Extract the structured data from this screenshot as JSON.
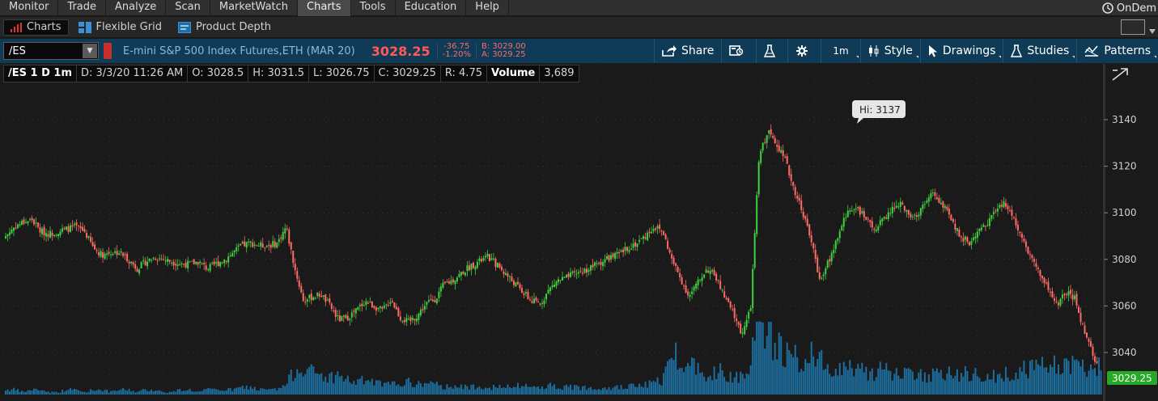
{
  "menubar": {
    "items": [
      "Monitor",
      "Trade",
      "Analyze",
      "Scan",
      "MarketWatch",
      "Charts",
      "Tools",
      "Education",
      "Help"
    ],
    "active": "Charts",
    "ondemand": "OnDem"
  },
  "subbar": {
    "tabs": [
      {
        "label": "Charts",
        "active": true
      },
      {
        "label": "Flexible Grid",
        "active": false
      },
      {
        "label": "Product Depth",
        "active": false
      }
    ]
  },
  "toolbar": {
    "symbol": "/ES",
    "description": "E-mini S&P 500 Index Futures,ETH (MAR 20)",
    "last": "3028.25",
    "net_change": "-36.75",
    "pct_change": "-1.20%",
    "bid": "B: 3029.00",
    "ask": "A: 3029.25",
    "share_label": "Share",
    "timeframe_label": "1m",
    "style_label": "Style",
    "drawings_label": "Drawings",
    "studies_label": "Studies",
    "patterns_label": "Patterns"
  },
  "header": {
    "title": "/ES 1 D 1m",
    "date": "D: 3/3/20 11:26 AM",
    "open": "O: 3028.5",
    "high": "H: 3031.5",
    "low": "L: 3026.75",
    "close": "C: 3029.25",
    "range": "R: 4.75",
    "volume_label": "Volume",
    "volume_value": "3,689"
  },
  "colors": {
    "up": "#3fd13f",
    "down": "#ff6b66",
    "volume": "#1d6fa0",
    "toolbar": "#0f3b57",
    "last_price_tag": "#27a827"
  },
  "chart_data": {
    "type": "candlestick",
    "x": "1-minute bars, 3/3/20",
    "y_axis": {
      "ticks": [
        3040,
        3060,
        3080,
        3100,
        3120,
        3140
      ],
      "range": [
        3026,
        3150
      ],
      "position": "right"
    },
    "high_label": "Hi: 3137",
    "high_value": 3137,
    "last_price_tag": "3029.25",
    "last_price_value": 3029.25,
    "approx_close_path": [
      3090,
      3094,
      3096,
      3097,
      3092,
      3091,
      3092,
      3093,
      3094,
      3092,
      3085,
      3082,
      3083,
      3083,
      3080,
      3076,
      3079,
      3081,
      3080,
      3079,
      3078,
      3078,
      3079,
      3076,
      3078,
      3080,
      3083,
      3086,
      3087,
      3086,
      3086,
      3087,
      3094,
      3076,
      3062,
      3064,
      3065,
      3060,
      3054,
      3055,
      3058,
      3062,
      3060,
      3058,
      3063,
      3055,
      3053,
      3056,
      3061,
      3063,
      3069,
      3071,
      3074,
      3077,
      3079,
      3081,
      3078,
      3074,
      3070,
      3066,
      3062,
      3061,
      3067,
      3071,
      3072,
      3074,
      3075,
      3077,
      3079,
      3081,
      3082,
      3085,
      3087,
      3090,
      3094,
      3092,
      3080,
      3072,
      3064,
      3070,
      3076,
      3073,
      3064,
      3057,
      3048,
      3058,
      3125,
      3135,
      3130,
      3122,
      3110,
      3100,
      3087,
      3070,
      3080,
      3090,
      3100,
      3103,
      3098,
      3093,
      3096,
      3101,
      3104,
      3100,
      3097,
      3106,
      3108,
      3103,
      3096,
      3090,
      3087,
      3092,
      3096,
      3101,
      3104,
      3098,
      3090,
      3081,
      3074,
      3067,
      3060,
      3066,
      3063,
      3050,
      3040,
      3029
    ],
    "approx_volume_path": [
      2,
      2,
      1,
      2,
      2,
      1,
      1,
      2,
      2,
      1,
      2,
      2,
      1,
      2,
      2,
      1,
      2,
      2,
      1,
      1,
      2,
      2,
      1,
      2,
      2,
      2,
      2,
      3,
      3,
      2,
      2,
      2,
      4,
      10,
      12,
      9,
      8,
      7,
      8,
      6,
      5,
      6,
      5,
      4,
      4,
      5,
      5,
      4,
      5,
      4,
      3,
      4,
      3,
      3,
      4,
      3,
      3,
      3,
      3,
      4,
      3,
      3,
      4,
      3,
      3,
      3,
      3,
      3,
      3,
      3,
      3,
      3,
      4,
      4,
      5,
      6,
      18,
      15,
      13,
      11,
      9,
      10,
      9,
      8,
      8,
      14,
      30,
      25,
      20,
      18,
      15,
      14,
      16,
      14,
      12,
      11,
      12,
      11,
      10,
      9,
      10,
      9,
      9,
      8,
      9,
      8,
      8,
      9,
      8,
      8,
      9,
      8,
      7,
      8,
      8,
      9,
      10,
      11,
      12,
      11,
      12,
      13,
      12,
      11,
      10,
      12
    ]
  }
}
